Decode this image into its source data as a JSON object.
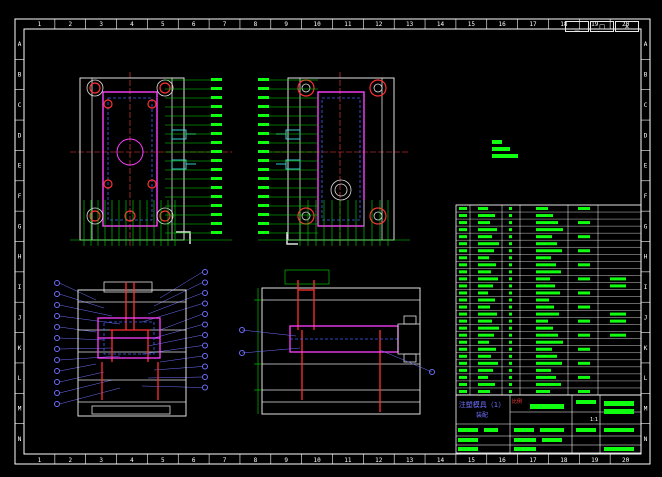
{
  "window": {
    "buttons": [
      {
        "label": "_"
      },
      {
        "label": "□"
      },
      {
        "label": "×"
      }
    ]
  },
  "border": {
    "top_numbers": [
      "1",
      "2",
      "3",
      "4",
      "5",
      "6",
      "7",
      "8",
      "9",
      "10",
      "11",
      "12",
      "13",
      "14",
      "15",
      "16",
      "17",
      "18",
      "19",
      "20"
    ],
    "side_letters": [
      "A",
      "B",
      "C",
      "D",
      "E",
      "F",
      "G",
      "H",
      "I",
      "J",
      "K",
      "L",
      "M",
      "N"
    ]
  },
  "title_block": {
    "drawing_name": "注塑模具（1）",
    "drawing_sub": "装配",
    "scale_label": "比例",
    "scale_value": "1:1"
  },
  "colors": {
    "background": "#000000",
    "frame": "#ffffff",
    "plate_outline": "#e0e0e0",
    "leader": "#00e000",
    "balloon": "#6f6fff",
    "part_red": "#ff3030",
    "part_magenta": "#ff40ff",
    "bolt_cyan": "#40e0e0",
    "table_fill": "#10ff10",
    "note_fill": "#10ff10"
  }
}
